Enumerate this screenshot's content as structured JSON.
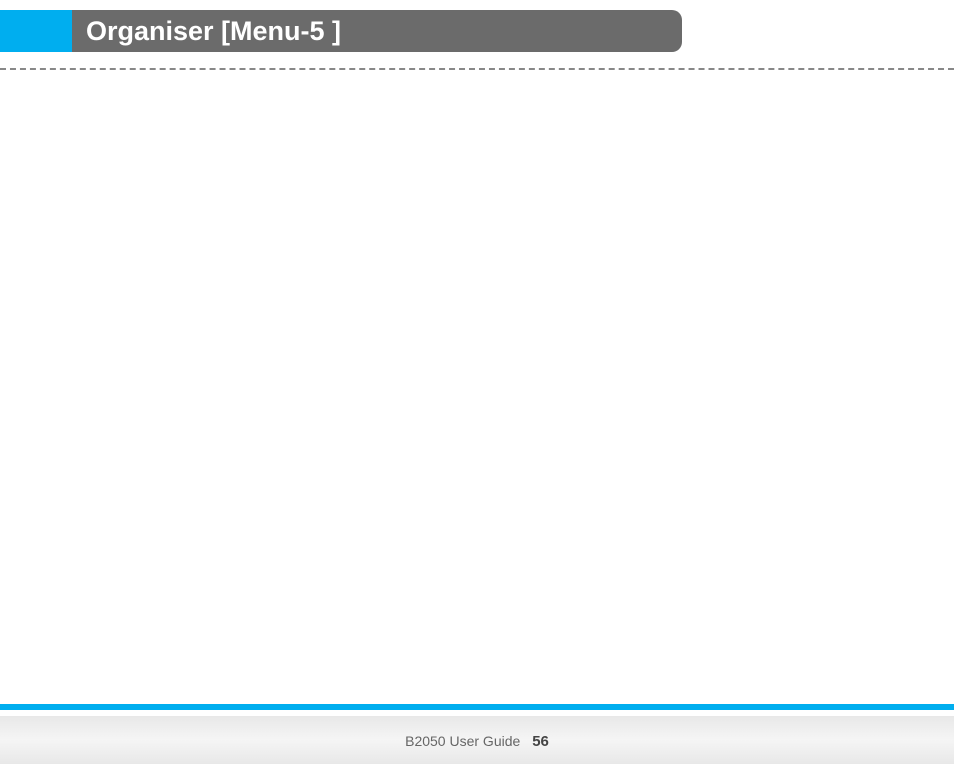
{
  "header": {
    "title": "Organiser [Menu-5 ]"
  },
  "footer": {
    "guide_label": "B2050 User Guide",
    "page_number": "56"
  }
}
